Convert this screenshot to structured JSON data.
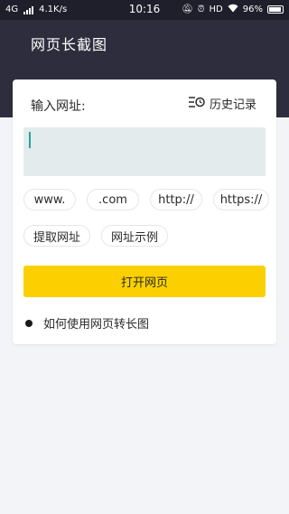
{
  "status_bar": {
    "network": "4G",
    "speed": "4.1K/s",
    "time": "10:16",
    "hd": "HD",
    "battery": "96%"
  },
  "header": {
    "title": "网页长截图"
  },
  "form": {
    "input_label": "输入网址:",
    "history_label": "历史记录",
    "url_value": "",
    "chips": [
      "www.",
      ".com",
      "http://",
      "https://"
    ],
    "actions": [
      "提取网址",
      "网址示例"
    ],
    "open_button": "打开网页",
    "howto_label": "如何使用网页转长图"
  },
  "colors": {
    "header_bg": "#2d2d3d",
    "status_bg": "#1f1f2b",
    "accent_yellow": "#fcd000",
    "input_bg": "#e4ebec",
    "caret": "#1aa89a"
  }
}
